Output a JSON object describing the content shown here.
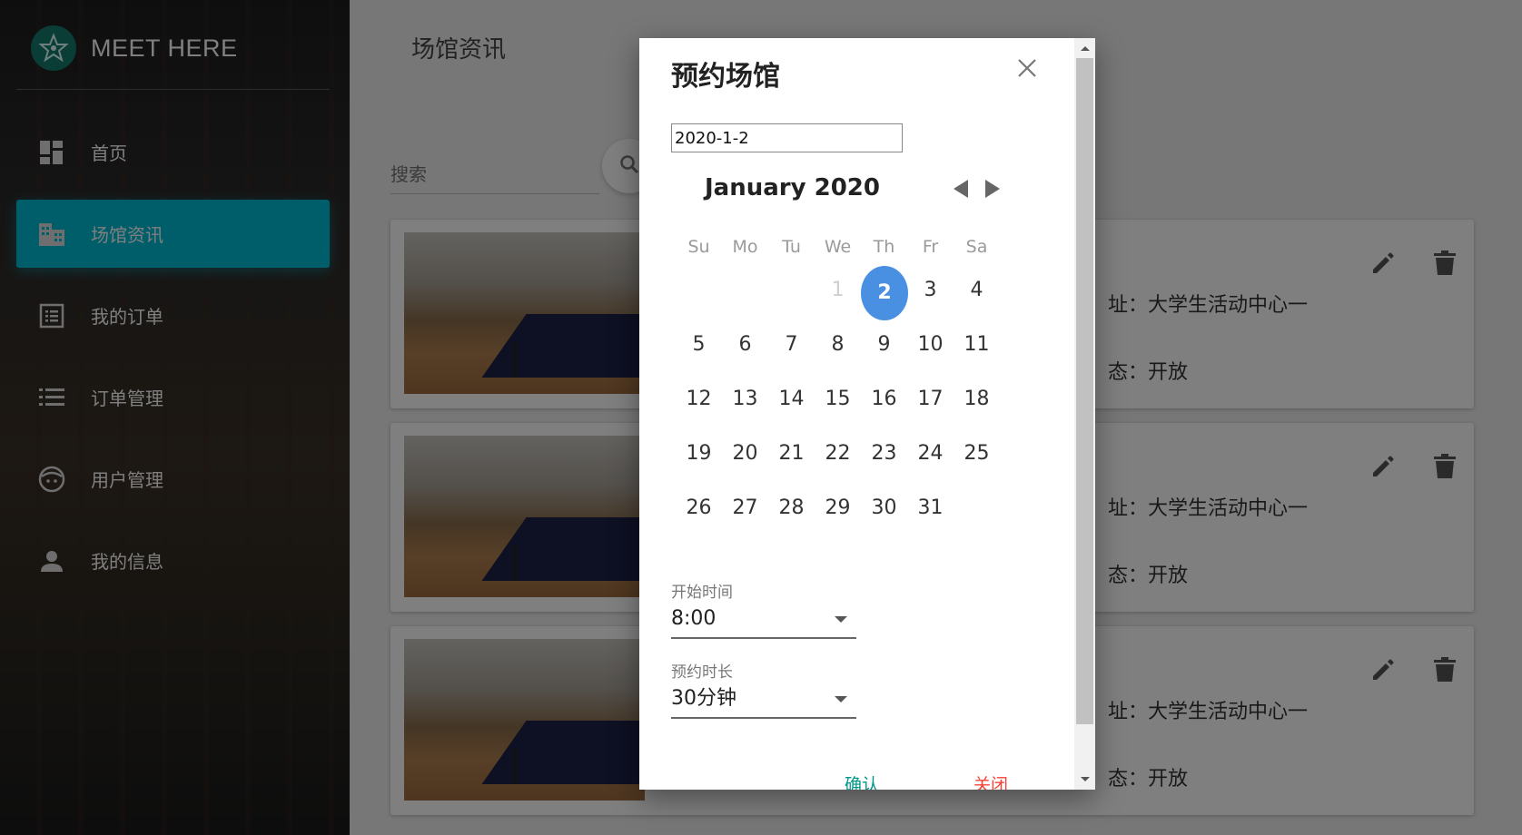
{
  "app": {
    "brand": "MEET HERE"
  },
  "sidebar": {
    "items": [
      {
        "label": "首页",
        "icon": "dashboard-icon"
      },
      {
        "label": "场馆资讯",
        "icon": "building-icon",
        "active": true
      },
      {
        "label": "我的订单",
        "icon": "list-box-icon"
      },
      {
        "label": "订单管理",
        "icon": "list-icon"
      },
      {
        "label": "用户管理",
        "icon": "face-icon"
      },
      {
        "label": "我的信息",
        "icon": "person-icon"
      }
    ]
  },
  "main": {
    "title": "场馆资讯",
    "search_placeholder": "搜索",
    "cards": [
      {
        "address": "址：大学生活动中心一",
        "status": "态：开放"
      },
      {
        "address": "址：大学生活动中心一",
        "status": "态：开放"
      },
      {
        "address": "址：大学生活动中心一",
        "status": "态：开放"
      }
    ]
  },
  "dialog": {
    "title": "预约场馆",
    "date_value": "2020-1-2",
    "calendar": {
      "month_label": "January 2020",
      "weekdays": [
        "Su",
        "Mo",
        "Tu",
        "We",
        "Th",
        "Fr",
        "Sa"
      ],
      "weeks": [
        [
          "",
          "",
          "",
          "1",
          "2",
          "3",
          "4"
        ],
        [
          "5",
          "6",
          "7",
          "8",
          "9",
          "10",
          "11"
        ],
        [
          "12",
          "13",
          "14",
          "15",
          "16",
          "17",
          "18"
        ],
        [
          "19",
          "20",
          "21",
          "22",
          "23",
          "24",
          "25"
        ],
        [
          "26",
          "27",
          "28",
          "29",
          "30",
          "31",
          ""
        ]
      ],
      "selected": "2",
      "muted": [
        "1"
      ]
    },
    "start_label": "开始时间",
    "start_value": "8:00",
    "duration_label": "预约时长",
    "duration_value": "30分钟",
    "confirm_label": "确认",
    "close_label": "关闭",
    "colors": {
      "accent": "#00bcd4",
      "selected": "#4a90e2",
      "confirm": "#009688",
      "close": "#f44336"
    }
  }
}
